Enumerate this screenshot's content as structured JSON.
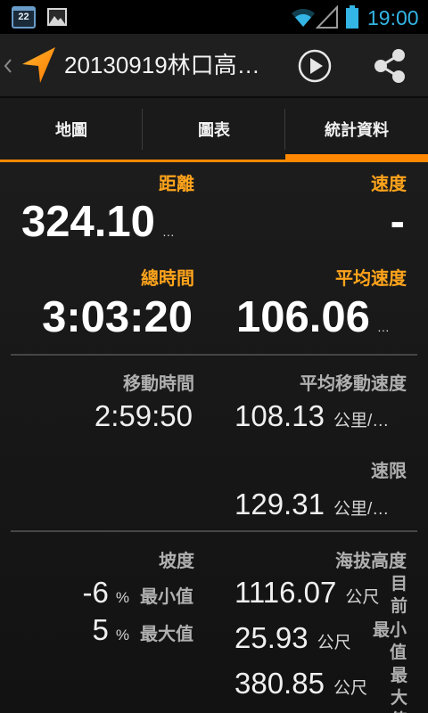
{
  "status_bar": {
    "calendar_day": "22",
    "time": "19:00",
    "icons": [
      "calendar-icon",
      "image-icon",
      "wifi-icon",
      "cell-signal-icon",
      "battery-icon"
    ]
  },
  "action_bar": {
    "title": "20130919林口高…",
    "icons": [
      "chevron-left-icon",
      "navigation-arrow-icon",
      "play-icon",
      "share-icon"
    ]
  },
  "tabs": [
    {
      "label": "地圖",
      "selected": false
    },
    {
      "label": "圖表",
      "selected": false
    },
    {
      "label": "統計資料",
      "selected": true
    }
  ],
  "stats": {
    "distance": {
      "label": "距離",
      "value": "324.10",
      "unit": "…"
    },
    "speed": {
      "label": "速度",
      "value": "-"
    },
    "total_time": {
      "label": "總時間",
      "value": "3:03:20"
    },
    "average_speed": {
      "label": "平均速度",
      "value": "106.06",
      "unit": "…"
    },
    "moving_time": {
      "label": "移動時間",
      "value": "2:59:50"
    },
    "average_moving_speed": {
      "label": "平均移動速度",
      "value": "108.13",
      "unit": "公里/…"
    },
    "max_speed": {
      "label": "速限",
      "value": "129.31",
      "unit": "公里/…"
    },
    "grade": {
      "label": "坡度",
      "min": {
        "value": "-6",
        "unit": "%",
        "label": "最小值"
      },
      "max": {
        "value": "5",
        "unit": "%",
        "label": "最大值"
      }
    },
    "elevation": {
      "label": "海拔高度",
      "current": {
        "value": "1116.07",
        "unit": "公尺",
        "label": "目前"
      },
      "min": {
        "value": "25.93",
        "unit": "公尺",
        "label": "最小值"
      },
      "max": {
        "value": "380.85",
        "unit": "公尺",
        "label": "最大值"
      }
    }
  },
  "colors": {
    "accent_orange": "#ff8800",
    "label_orange": "#ffa41c",
    "status_blue": "#33b5e5",
    "secondary_label_gray": "#b0b0b0"
  }
}
